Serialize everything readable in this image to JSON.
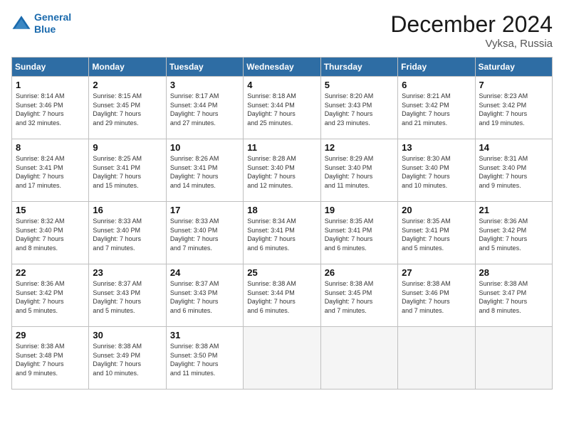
{
  "logo": {
    "line1": "General",
    "line2": "Blue"
  },
  "title": "December 2024",
  "location": "Vyksa, Russia",
  "days_of_week": [
    "Sunday",
    "Monday",
    "Tuesday",
    "Wednesday",
    "Thursday",
    "Friday",
    "Saturday"
  ],
  "weeks": [
    [
      {
        "day": "1",
        "info": "Sunrise: 8:14 AM\nSunset: 3:46 PM\nDaylight: 7 hours\nand 32 minutes."
      },
      {
        "day": "2",
        "info": "Sunrise: 8:15 AM\nSunset: 3:45 PM\nDaylight: 7 hours\nand 29 minutes."
      },
      {
        "day": "3",
        "info": "Sunrise: 8:17 AM\nSunset: 3:44 PM\nDaylight: 7 hours\nand 27 minutes."
      },
      {
        "day": "4",
        "info": "Sunrise: 8:18 AM\nSunset: 3:44 PM\nDaylight: 7 hours\nand 25 minutes."
      },
      {
        "day": "5",
        "info": "Sunrise: 8:20 AM\nSunset: 3:43 PM\nDaylight: 7 hours\nand 23 minutes."
      },
      {
        "day": "6",
        "info": "Sunrise: 8:21 AM\nSunset: 3:42 PM\nDaylight: 7 hours\nand 21 minutes."
      },
      {
        "day": "7",
        "info": "Sunrise: 8:23 AM\nSunset: 3:42 PM\nDaylight: 7 hours\nand 19 minutes."
      }
    ],
    [
      {
        "day": "8",
        "info": "Sunrise: 8:24 AM\nSunset: 3:41 PM\nDaylight: 7 hours\nand 17 minutes."
      },
      {
        "day": "9",
        "info": "Sunrise: 8:25 AM\nSunset: 3:41 PM\nDaylight: 7 hours\nand 15 minutes."
      },
      {
        "day": "10",
        "info": "Sunrise: 8:26 AM\nSunset: 3:41 PM\nDaylight: 7 hours\nand 14 minutes."
      },
      {
        "day": "11",
        "info": "Sunrise: 8:28 AM\nSunset: 3:40 PM\nDaylight: 7 hours\nand 12 minutes."
      },
      {
        "day": "12",
        "info": "Sunrise: 8:29 AM\nSunset: 3:40 PM\nDaylight: 7 hours\nand 11 minutes."
      },
      {
        "day": "13",
        "info": "Sunrise: 8:30 AM\nSunset: 3:40 PM\nDaylight: 7 hours\nand 10 minutes."
      },
      {
        "day": "14",
        "info": "Sunrise: 8:31 AM\nSunset: 3:40 PM\nDaylight: 7 hours\nand 9 minutes."
      }
    ],
    [
      {
        "day": "15",
        "info": "Sunrise: 8:32 AM\nSunset: 3:40 PM\nDaylight: 7 hours\nand 8 minutes."
      },
      {
        "day": "16",
        "info": "Sunrise: 8:33 AM\nSunset: 3:40 PM\nDaylight: 7 hours\nand 7 minutes."
      },
      {
        "day": "17",
        "info": "Sunrise: 8:33 AM\nSunset: 3:40 PM\nDaylight: 7 hours\nand 7 minutes."
      },
      {
        "day": "18",
        "info": "Sunrise: 8:34 AM\nSunset: 3:41 PM\nDaylight: 7 hours\nand 6 minutes."
      },
      {
        "day": "19",
        "info": "Sunrise: 8:35 AM\nSunset: 3:41 PM\nDaylight: 7 hours\nand 6 minutes."
      },
      {
        "day": "20",
        "info": "Sunrise: 8:35 AM\nSunset: 3:41 PM\nDaylight: 7 hours\nand 5 minutes."
      },
      {
        "day": "21",
        "info": "Sunrise: 8:36 AM\nSunset: 3:42 PM\nDaylight: 7 hours\nand 5 minutes."
      }
    ],
    [
      {
        "day": "22",
        "info": "Sunrise: 8:36 AM\nSunset: 3:42 PM\nDaylight: 7 hours\nand 5 minutes."
      },
      {
        "day": "23",
        "info": "Sunrise: 8:37 AM\nSunset: 3:43 PM\nDaylight: 7 hours\nand 5 minutes."
      },
      {
        "day": "24",
        "info": "Sunrise: 8:37 AM\nSunset: 3:43 PM\nDaylight: 7 hours\nand 6 minutes."
      },
      {
        "day": "25",
        "info": "Sunrise: 8:38 AM\nSunset: 3:44 PM\nDaylight: 7 hours\nand 6 minutes."
      },
      {
        "day": "26",
        "info": "Sunrise: 8:38 AM\nSunset: 3:45 PM\nDaylight: 7 hours\nand 7 minutes."
      },
      {
        "day": "27",
        "info": "Sunrise: 8:38 AM\nSunset: 3:46 PM\nDaylight: 7 hours\nand 7 minutes."
      },
      {
        "day": "28",
        "info": "Sunrise: 8:38 AM\nSunset: 3:47 PM\nDaylight: 7 hours\nand 8 minutes."
      }
    ],
    [
      {
        "day": "29",
        "info": "Sunrise: 8:38 AM\nSunset: 3:48 PM\nDaylight: 7 hours\nand 9 minutes."
      },
      {
        "day": "30",
        "info": "Sunrise: 8:38 AM\nSunset: 3:49 PM\nDaylight: 7 hours\nand 10 minutes."
      },
      {
        "day": "31",
        "info": "Sunrise: 8:38 AM\nSunset: 3:50 PM\nDaylight: 7 hours\nand 11 minutes."
      },
      {
        "day": "",
        "info": ""
      },
      {
        "day": "",
        "info": ""
      },
      {
        "day": "",
        "info": ""
      },
      {
        "day": "",
        "info": ""
      }
    ]
  ]
}
